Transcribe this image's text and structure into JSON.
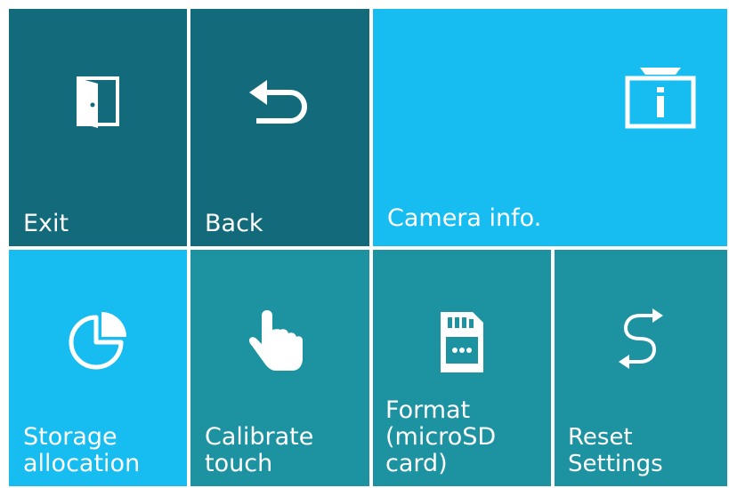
{
  "menu": {
    "tiles": [
      {
        "label": "Exit",
        "icon": "exit-door-icon"
      },
      {
        "label": "Back",
        "icon": "back-arrow-icon"
      },
      {
        "label": "Camera info.",
        "icon": "camera-info-icon"
      },
      {
        "label": "Storage\nallocation",
        "icon": "pie-chart-icon"
      },
      {
        "label": "Calibrate\ntouch",
        "icon": "pointing-hand-icon"
      },
      {
        "label": "Format\n(microSD card)",
        "icon": "sd-card-icon"
      },
      {
        "label": "Reset Settings",
        "icon": "reset-arrows-icon"
      }
    ]
  },
  "colors": {
    "dark_tile": "#136a7b",
    "light_tile": "#17bdf0",
    "teal_tile": "#1d92a1",
    "text": "#ffffff"
  }
}
